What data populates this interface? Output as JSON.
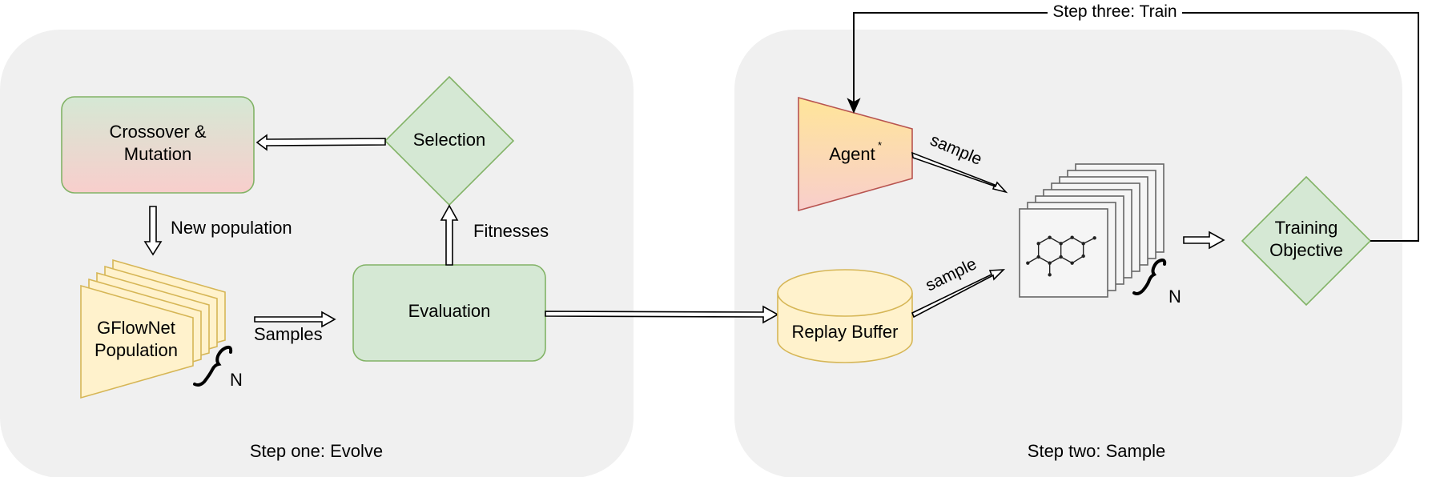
{
  "colors": {
    "panel_bg": "#f0f0f0",
    "green_fill": "#d5e8d4",
    "green_stroke": "#82b366",
    "red_fill": "#f8cecc",
    "yellow_fill": "#fff2cc",
    "yellow_stroke": "#d6b656",
    "agent_top": "#ffe599",
    "agent_bottom": "#f8cecc",
    "agent_stroke": "#b85450",
    "card_fill": "#f5f5f5",
    "card_stroke": "#666666",
    "arrow": "#000000"
  },
  "panels": {
    "evolve": {
      "caption": "Step one: Evolve"
    },
    "sample": {
      "caption": "Step two: Sample"
    }
  },
  "nodes": {
    "crossover": {
      "line1": "Crossover &",
      "line2": "Mutation"
    },
    "selection": {
      "label": "Selection"
    },
    "evaluation": {
      "label": "Evaluation"
    },
    "population": {
      "line1": "GFlowNet",
      "line2": "Population",
      "count_label": "N",
      "stack_count": 5
    },
    "agent": {
      "label": "Agent",
      "superscript": "*"
    },
    "replay_buffer": {
      "label": "Replay Buffer"
    },
    "samples_stack": {
      "count_label": "N",
      "stack_count": 8,
      "icon": "molecule-icon"
    },
    "training_objective": {
      "line1": "Training",
      "line2": "Objective"
    }
  },
  "edges": {
    "new_population": {
      "label": "New population"
    },
    "fitnesses": {
      "label": "Fitnesses"
    },
    "samples": {
      "label": "Samples"
    },
    "agent_sample": {
      "label": "sample"
    },
    "buffer_sample": {
      "label": "sample"
    },
    "train_loop": {
      "label": "Step three: Train"
    }
  }
}
